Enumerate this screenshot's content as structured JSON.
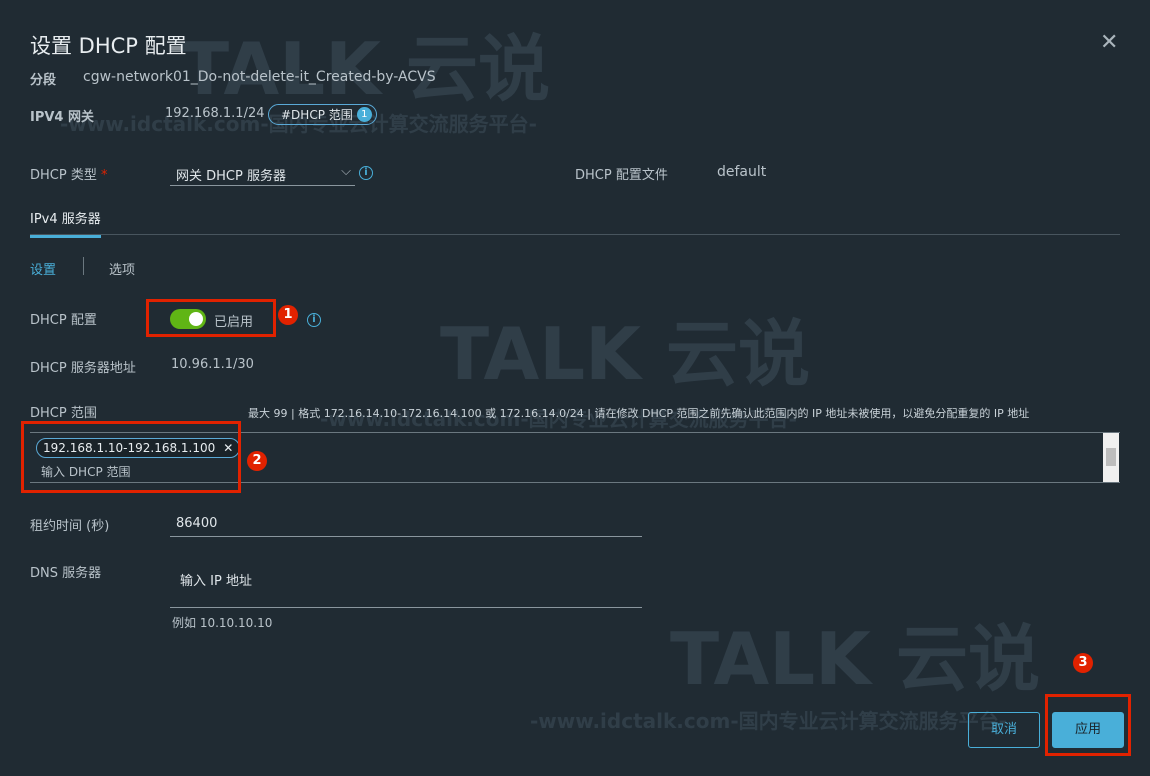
{
  "dialog": {
    "title": "设置 DHCP 配置",
    "close_icon": "close-icon"
  },
  "segment": {
    "label": "分段",
    "value": "cgw-network01_Do-not-delete-it_Created-by-ACVS"
  },
  "gateway": {
    "label": "IPV4 网关",
    "value": "192.168.1.1/24",
    "pill": "#DHCP 范围",
    "pill_count": "1"
  },
  "dhcp_type": {
    "label": "DHCP 类型",
    "required": "*",
    "value": "网关 DHCP 服务器",
    "profile_label": "DHCP 配置文件",
    "profile_value": "default"
  },
  "tabs": [
    {
      "label": "IPv4 服务器",
      "active": true
    }
  ],
  "subtabs": [
    {
      "label": "设置",
      "active": true
    },
    {
      "label": "选项"
    }
  ],
  "dhcp_config": {
    "label": "DHCP 配置",
    "toggle_on": true,
    "toggle_text": "已启用"
  },
  "server_addr": {
    "label": "DHCP 服务器地址",
    "value": "10.96.1.1/30"
  },
  "dhcp_range": {
    "label": "DHCP 范围",
    "hint": "最大 99 | 格式 172.16.14.10-172.16.14.100 或 172.16.14.0/24 | 请在修改 DHCP 范围之前先确认此范围内的 IP 地址未被使用，以避免分配重复的 IP 地址",
    "chips": [
      "192.168.1.10-192.168.1.100"
    ],
    "placeholder": "输入 DHCP 范围"
  },
  "lease": {
    "label": "租约时间 (秒)",
    "value": "86400"
  },
  "dns": {
    "label": "DNS 服务器",
    "placeholder": "输入 IP 地址",
    "example": "例如 10.10.10.10"
  },
  "annotations": [
    "1",
    "2",
    "3"
  ],
  "buttons": {
    "cancel": "取消",
    "apply": "应用"
  },
  "watermark": {
    "logo": "TALK 云说",
    "url": "-www.idctalk.com-国内专业云计算交流服务平台-"
  },
  "colors": {
    "accent": "#49afd9",
    "toggle": "#60b515",
    "annotation": "#e12200",
    "background": "#202b33"
  }
}
